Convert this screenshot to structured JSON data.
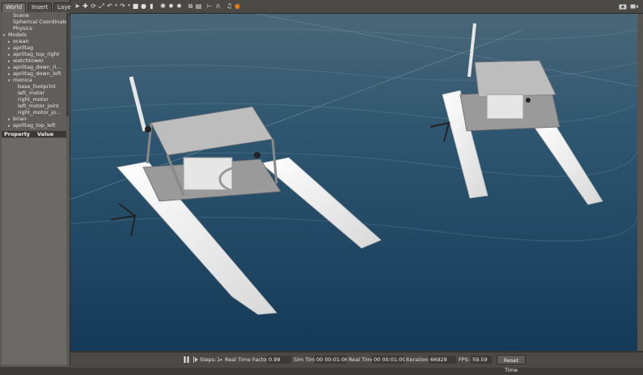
{
  "left_panel": {
    "tabs": [
      "World",
      "Insert",
      "Layers"
    ],
    "tree": [
      {
        "label": "Scene",
        "indent": 1,
        "arrow": ""
      },
      {
        "label": "Spherical Coordinates",
        "indent": 1,
        "arrow": ""
      },
      {
        "label": "Physics",
        "indent": 1,
        "arrow": ""
      },
      {
        "label": "Models",
        "indent": 0,
        "arrow": "▾"
      },
      {
        "label": "ocean",
        "indent": 1,
        "arrow": "▸"
      },
      {
        "label": "apriltag",
        "indent": 1,
        "arrow": "▸"
      },
      {
        "label": "apriltag_top_right",
        "indent": 1,
        "arrow": "▸"
      },
      {
        "label": "watchtower",
        "indent": 1,
        "arrow": "▸"
      },
      {
        "label": "apriltag_down_ri...",
        "indent": 1,
        "arrow": "▸"
      },
      {
        "label": "apriltag_down_left",
        "indent": 1,
        "arrow": "▸"
      },
      {
        "label": "monica",
        "indent": 1,
        "arrow": "▾"
      },
      {
        "label": "base_footprint",
        "indent": 2,
        "arrow": ""
      },
      {
        "label": "left_motor",
        "indent": 2,
        "arrow": ""
      },
      {
        "label": "right_motor",
        "indent": 2,
        "arrow": ""
      },
      {
        "label": "left_motor_joint",
        "indent": 2,
        "arrow": ""
      },
      {
        "label": "right_motor_jo...",
        "indent": 2,
        "arrow": ""
      },
      {
        "label": "brian",
        "indent": 1,
        "arrow": "▸"
      },
      {
        "label": "apriltag_top_left",
        "indent": 1,
        "arrow": "▸"
      }
    ],
    "property_header": "Property",
    "value_header": "Value"
  },
  "toolbar": {
    "icons": [
      "select-arrow-icon",
      "translate-icon",
      "rotate-icon",
      "scale-icon",
      "undo-icon",
      "undo-menu-icon",
      "redo-icon",
      "redo-menu-icon",
      "box-icon",
      "sphere-icon",
      "cylinder-icon",
      "point-light-icon",
      "spot-light-icon",
      "directional-light-icon",
      "copy-icon",
      "paste-icon",
      "align-icon",
      "snap-icon",
      "audio-icon",
      "record-icon"
    ],
    "screenshot_icon": "camera-icon",
    "record_video_icon": "video-icon",
    "accent": "#e07a1e"
  },
  "bottom_bar": {
    "steps_label": "Steps:",
    "steps_value": "1",
    "rtf_label": "Real Time Factor:",
    "rtf_value": "0.99",
    "sim_time_label": "Sim Time:",
    "sim_time_value": "00 00:01:06.939",
    "real_time_label": "Real Time:",
    "real_time_value": "00 00:01:09.668",
    "iterations_label": "Iterations:",
    "iterations_value": "66929",
    "fps_label": "FPS:",
    "fps_value": "59.59",
    "reset_label": "Reset Time"
  }
}
